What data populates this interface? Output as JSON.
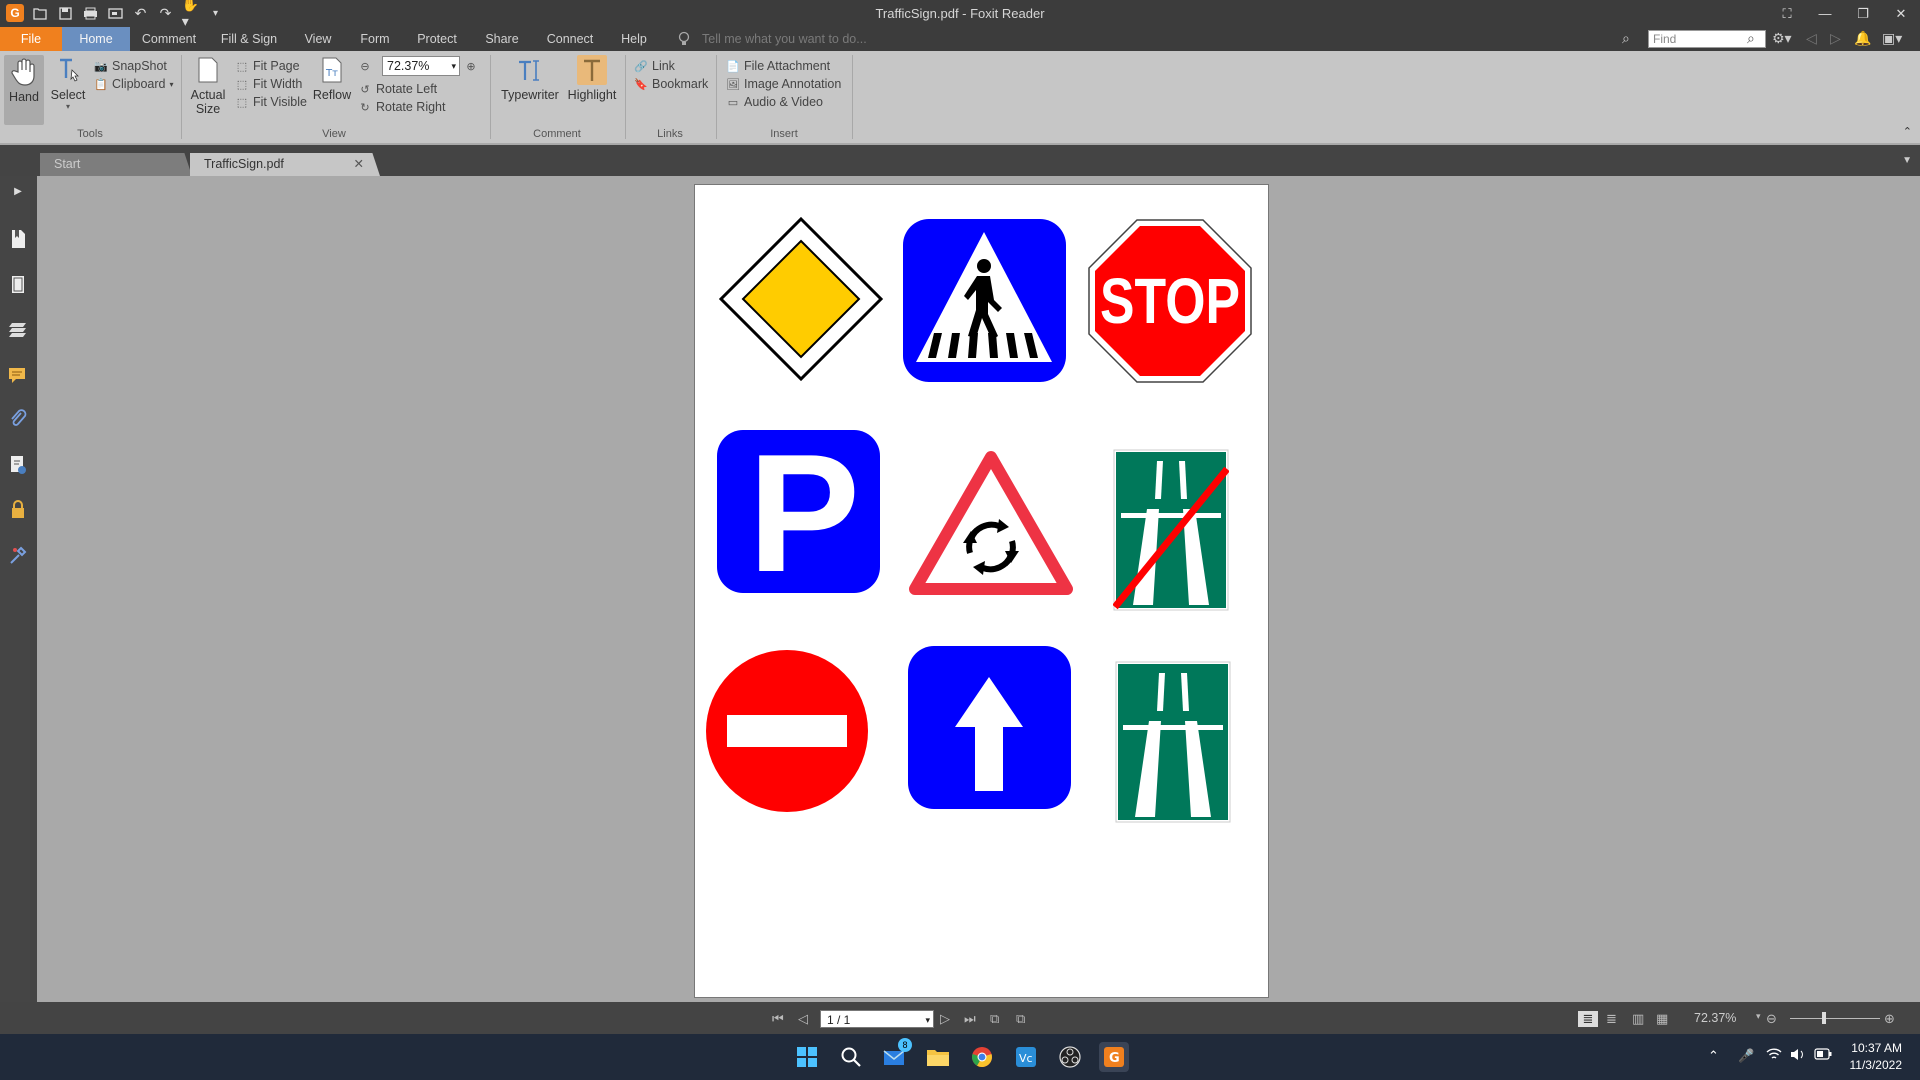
{
  "window": {
    "title": "TrafficSign.pdf - Foxit Reader"
  },
  "menu": {
    "tabs": [
      "File",
      "Home",
      "Comment",
      "Fill & Sign",
      "View",
      "Form",
      "Protect",
      "Share",
      "Connect",
      "Help"
    ],
    "active": "Home",
    "tell_me_placeholder": "Tell me what you want to do...",
    "find_placeholder": "Find"
  },
  "ribbon": {
    "tools": {
      "label": "Tools",
      "hand": "Hand",
      "select": "Select",
      "snapshot": "SnapShot",
      "clipboard": "Clipboard"
    },
    "view": {
      "label": "View",
      "actual_size_1": "Actual",
      "actual_size_2": "Size",
      "fit_page": "Fit Page",
      "fit_width": "Fit Width",
      "fit_visible": "Fit Visible",
      "reflow": "Reflow",
      "zoom_value": "72.37%",
      "rotate_left": "Rotate Left",
      "rotate_right": "Rotate Right"
    },
    "comment": {
      "label": "Comment",
      "typewriter": "Typewriter",
      "highlight": "Highlight"
    },
    "links": {
      "label": "Links",
      "link": "Link",
      "bookmark": "Bookmark"
    },
    "insert": {
      "label": "Insert",
      "file_attachment": "File Attachment",
      "image_annotation": "Image Annotation",
      "audio_video": "Audio & Video"
    }
  },
  "doc_tabs": {
    "start": "Start",
    "current": "TrafficSign.pdf"
  },
  "page": {
    "stop_text": "STOP",
    "parking_text": "P"
  },
  "status": {
    "page_indicator": "1 / 1",
    "zoom": "72.37%"
  },
  "taskbar": {
    "mail_badge": "8",
    "time": "10:37 AM",
    "date": "11/3/2022"
  },
  "colors": {
    "accent_file": "#f0801e",
    "sign_blue": "#0000ff",
    "sign_red": "#ff0000",
    "sign_green": "#00785a",
    "sign_yellow": "#ffcc00"
  }
}
